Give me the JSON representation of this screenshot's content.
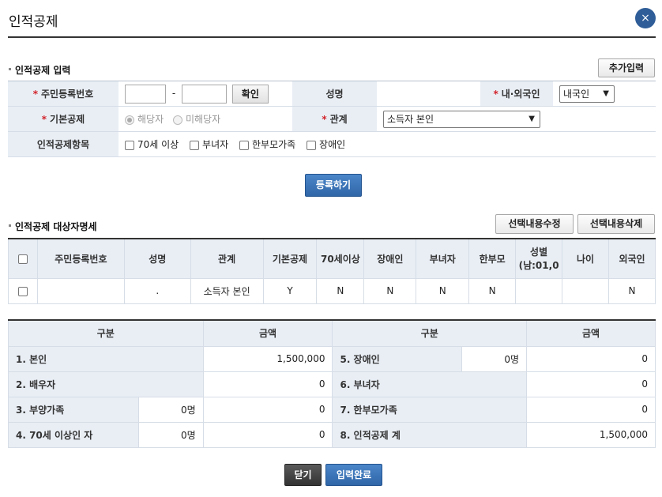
{
  "window": {
    "title": "인적공제",
    "close": "×"
  },
  "input_section": {
    "heading": "인적공제 입력",
    "add_button": "추가입력",
    "ssn_label": "주민등록번호",
    "ssn_dash": "-",
    "confirm_button": "확인",
    "name_label": "성명",
    "nationality_label": "내·외국인",
    "nationality_value": "내국인",
    "basic_label": "기본공제",
    "basic_options": [
      "해당자",
      "미해당자"
    ],
    "relation_label": "관계",
    "relation_value": "소득자 본인",
    "items_label": "인적공제항목",
    "items": [
      "70세 이상",
      "부녀자",
      "한부모가족",
      "장애인"
    ],
    "register_button": "등록하기"
  },
  "list_section": {
    "heading": "인적공제 대상자명세",
    "edit_button": "선택내용수정",
    "delete_button": "선택내용삭제",
    "columns": [
      "주민등록번호",
      "성명",
      "관계",
      "기본공제",
      "70세이상",
      "장애인",
      "부녀자",
      "한부모",
      "성별\n(남:01,0",
      "나이",
      "외국인"
    ],
    "row": {
      "ssn": "",
      "name": ".",
      "relation": "소득자 본인",
      "basic": "Y",
      "over70": "N",
      "disabled": "N",
      "woman": "N",
      "single": "N",
      "gender": "",
      "age": "",
      "foreign": "N"
    }
  },
  "summary": {
    "headers": [
      "구분",
      "금액",
      "구분",
      "금액"
    ],
    "rows": [
      {
        "label": "1. 본인",
        "count": "",
        "amount": "1,500,000",
        "label2": "5. 장애인",
        "count2": "0명",
        "amount2": "0"
      },
      {
        "label": "2. 배우자",
        "count": "",
        "amount": "0",
        "label2": "6. 부녀자",
        "count2": "",
        "amount2": "0"
      },
      {
        "label": "3. 부양가족",
        "count": "0명",
        "amount": "0",
        "label2": "7. 한부모가족",
        "count2": "",
        "amount2": "0"
      },
      {
        "label": "4. 70세 이상인 자",
        "count": "0명",
        "amount": "0",
        "label2": "8. 인적공제 계",
        "count2": "",
        "amount2": "1,500,000"
      }
    ]
  },
  "footer": {
    "close_button": "닫기",
    "done_button": "입력완료"
  }
}
